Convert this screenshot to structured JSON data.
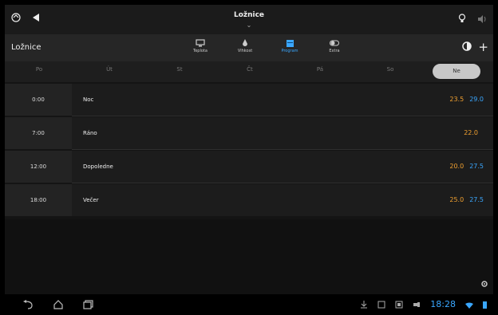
{
  "topbar": {
    "title": "Ložnice"
  },
  "toolbar": {
    "room_label": "Ložnice",
    "tabs": [
      {
        "label": "Teplota"
      },
      {
        "label": "Vlhkost"
      },
      {
        "label": "Program"
      },
      {
        "label": "Extra"
      }
    ],
    "add_label": "+"
  },
  "days": [
    {
      "label": "Po"
    },
    {
      "label": "Út"
    },
    {
      "label": "St"
    },
    {
      "label": "Čt"
    },
    {
      "label": "Pá"
    },
    {
      "label": "So"
    },
    {
      "label": "Ne"
    }
  ],
  "schedule": [
    {
      "time": "0:00",
      "name": "Noc",
      "t1": "23.5",
      "t2": "29.0"
    },
    {
      "time": "7:00",
      "name": "Ráno",
      "t1": "22.0",
      "t2": ""
    },
    {
      "time": "12:00",
      "name": "Dopoledne",
      "t1": "20.0",
      "t2": "27.5"
    },
    {
      "time": "18:00",
      "name": "Večer",
      "t1": "25.0",
      "t2": "27.5"
    }
  ],
  "status": {
    "clock": "18:28"
  },
  "colors": {
    "accent": "#3aa7ff",
    "heat": "#f0a030",
    "active_day": "#c8c8c8"
  }
}
